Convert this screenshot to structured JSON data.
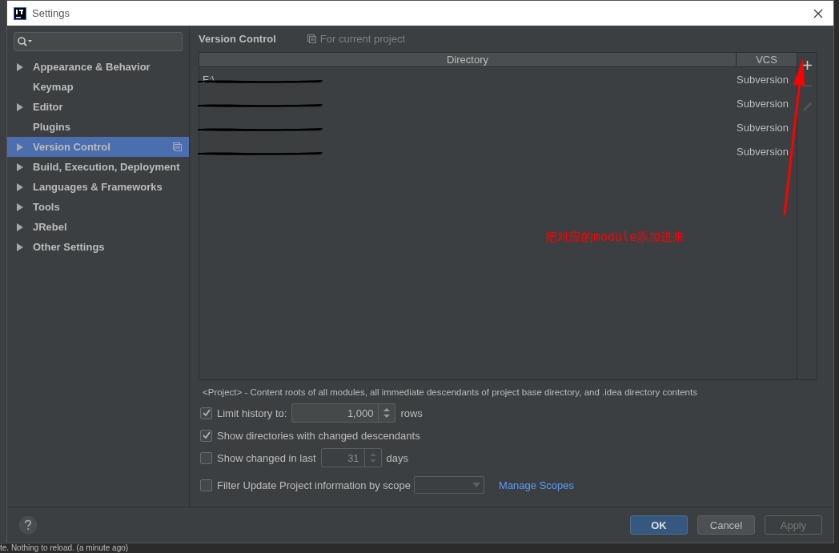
{
  "window": {
    "title": "Settings"
  },
  "sidebar": {
    "items": [
      {
        "label": "Appearance & Behavior",
        "expandable": true,
        "selected": false,
        "project_scope": false
      },
      {
        "label": "Keymap",
        "expandable": false,
        "selected": false,
        "project_scope": false
      },
      {
        "label": "Editor",
        "expandable": true,
        "selected": false,
        "project_scope": false
      },
      {
        "label": "Plugins",
        "expandable": false,
        "selected": false,
        "project_scope": false
      },
      {
        "label": "Version Control",
        "expandable": true,
        "selected": true,
        "project_scope": true
      },
      {
        "label": "Build, Execution, Deployment",
        "expandable": true,
        "selected": false,
        "project_scope": false
      },
      {
        "label": "Languages & Frameworks",
        "expandable": true,
        "selected": false,
        "project_scope": false
      },
      {
        "label": "Tools",
        "expandable": true,
        "selected": false,
        "project_scope": false
      },
      {
        "label": "JRebel",
        "expandable": true,
        "selected": false,
        "project_scope": false
      },
      {
        "label": "Other Settings",
        "expandable": true,
        "selected": false,
        "project_scope": false
      }
    ]
  },
  "page": {
    "title": "Version Control",
    "scope_note": "For current project"
  },
  "table": {
    "columns": [
      "Directory",
      "VCS"
    ],
    "rows": [
      {
        "directory": "F:\\",
        "redacted": true,
        "vcs": "Subversion"
      },
      {
        "redacted": true,
        "vcs": "Subversion"
      },
      {
        "redacted": true,
        "vcs": "Subversion"
      },
      {
        "redacted": true,
        "vcs": "Subversion"
      }
    ],
    "toolbar": [
      {
        "kind": "add",
        "disabled": false
      },
      {
        "kind": "remove",
        "disabled": true
      },
      {
        "kind": "edit",
        "disabled": true
      }
    ]
  },
  "annotation": "把对应的module添加进来",
  "note": "<Project> - Content roots of all modules, all immediate descendants of project base directory, and .idea directory contents",
  "options": [
    {
      "kind": "spinner",
      "label": "Limit history to:",
      "checked": true,
      "value": "1,000",
      "suffix": "rows",
      "disabled": false
    },
    {
      "kind": "checkbox",
      "label": "Show directories with changed descendants",
      "checked": true
    },
    {
      "kind": "spinner",
      "label": "Show changed in last",
      "checked": false,
      "value": "31",
      "suffix": "days",
      "disabled": true
    },
    {
      "kind": "scope",
      "label": "Filter Update Project information by scope",
      "checked": false,
      "link": "Manage Scopes"
    }
  ],
  "buttons": [
    {
      "label": "OK",
      "kind": "primary",
      "disabled": false
    },
    {
      "label": "Cancel",
      "kind": "normal",
      "disabled": false
    },
    {
      "label": "Apply",
      "kind": "normal",
      "disabled": true
    }
  ],
  "status_bar": {
    "text": "te. Nothing to reload. (a minute ago)"
  }
}
